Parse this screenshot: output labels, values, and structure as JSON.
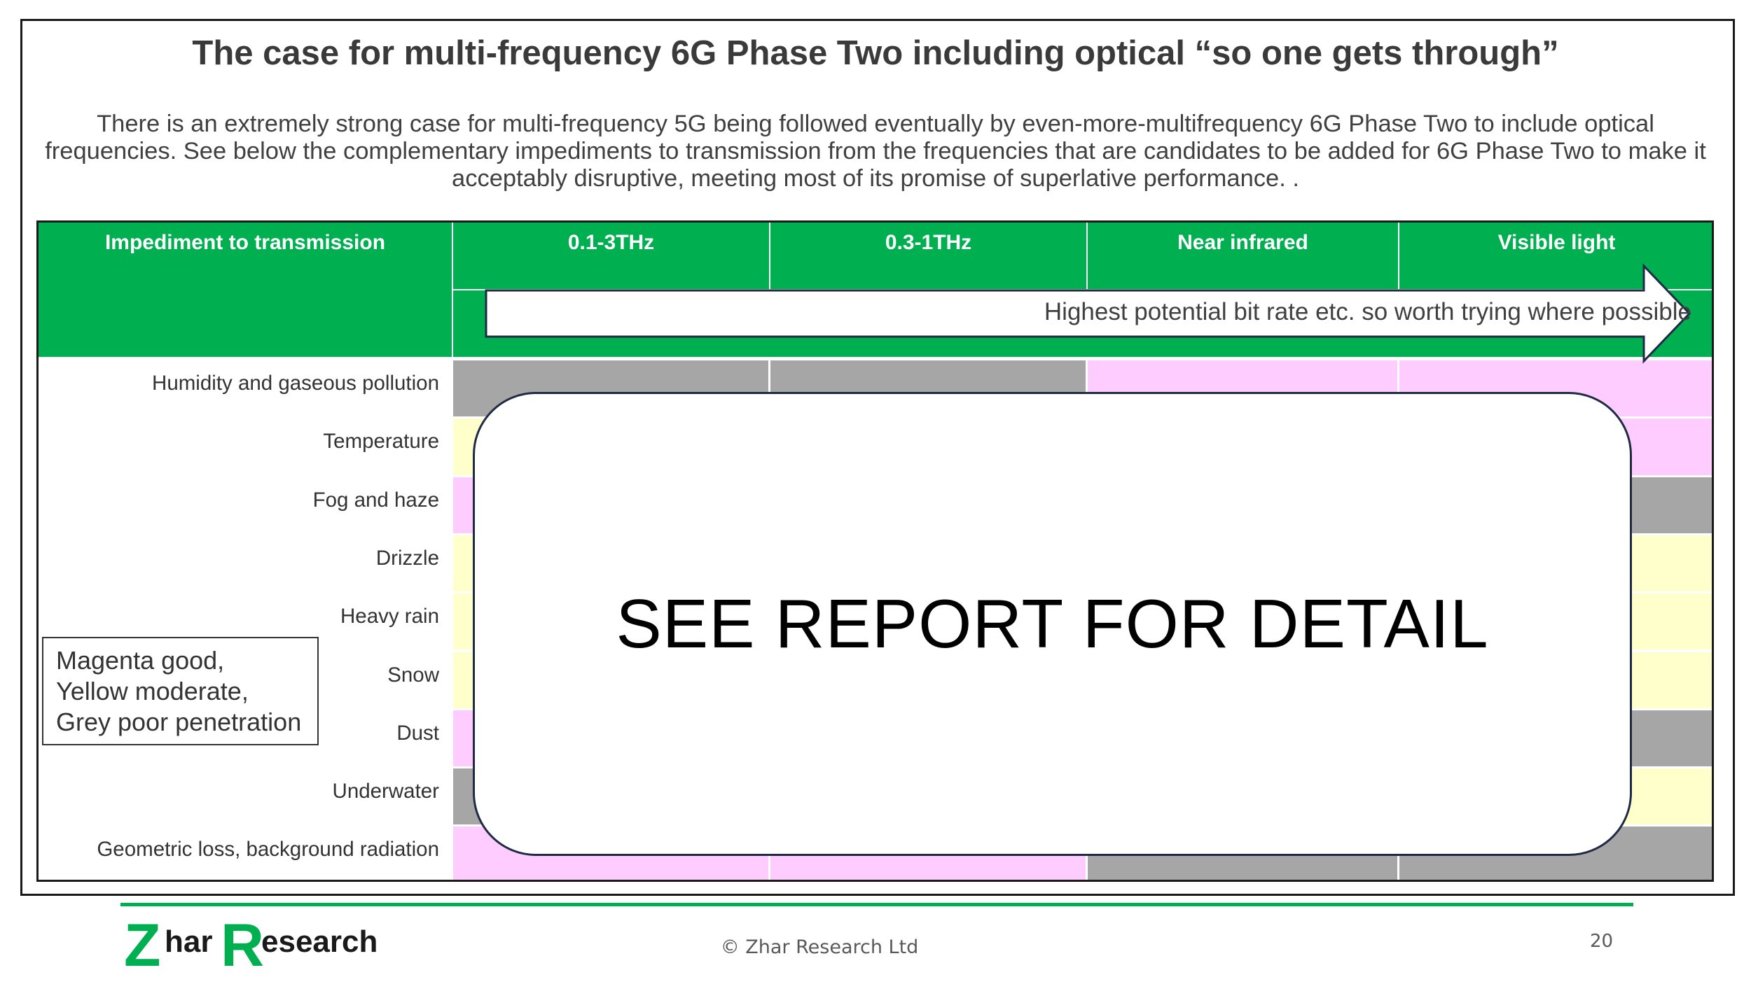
{
  "title": "The case for multi-frequency 6G Phase Two including optical “so one gets through”",
  "intro": "There is an extremely strong case for multi-frequency 5G being followed eventually by even-more-multifrequency 6G Phase Two to include optical frequencies.  See below the complementary impediments to transmission from the frequencies that are candidates to be added for 6G Phase Two to make it acceptably disruptive, meeting most of its promise of superlative performance.  .",
  "table": {
    "headers": [
      "Impediment to transmission",
      "0.1-3THz",
      "0.3-1THz",
      "Near infrared",
      "Visible light"
    ],
    "arrow_text": "Highest potential bit rate etc. so worth trying where possible",
    "rows": [
      {
        "label": "Humidity and gaseous pollution",
        "cells": [
          "grey",
          "grey",
          "magenta",
          "magenta"
        ]
      },
      {
        "label": "Temperature",
        "cells": [
          "yellow",
          "yellow",
          "magenta",
          "magenta"
        ]
      },
      {
        "label": "Fog and haze",
        "cells": [
          "magenta",
          "magenta",
          "grey",
          "grey"
        ]
      },
      {
        "label": "Drizzle",
        "cells": [
          "yellow",
          "yellow",
          "yellow",
          "yellow"
        ]
      },
      {
        "label": "Heavy rain",
        "cells": [
          "yellow",
          "yellow",
          "yellow",
          "yellow"
        ]
      },
      {
        "label": "Snow",
        "cells": [
          "yellow",
          "yellow",
          "yellow",
          "yellow"
        ]
      },
      {
        "label": "Dust",
        "cells": [
          "magenta",
          "magenta",
          "grey",
          "grey"
        ]
      },
      {
        "label": "Underwater",
        "cells": [
          "grey",
          "grey",
          "yellow",
          "yellow"
        ]
      },
      {
        "label": "Geometric loss, background radiation",
        "cells": [
          "magenta",
          "magenta",
          "grey",
          "grey"
        ]
      }
    ]
  },
  "overlay_text": "SEE REPORT FOR DETAIL",
  "legend": {
    "line1": "Magenta good,",
    "line2": "Yellow moderate,",
    "line3": "Grey poor penetration"
  },
  "footer": {
    "logo_letter_z": "Z",
    "logo_har": "har",
    "logo_letter_r": "R",
    "logo_esearch": "esearch",
    "copyright": "© Zhar Research Ltd",
    "page_number": "20"
  },
  "colors": {
    "header_green": "#00b050",
    "good_magenta": "#ffccff",
    "moderate_yellow": "#ffffcc",
    "poor_grey": "#a6a6a6"
  }
}
